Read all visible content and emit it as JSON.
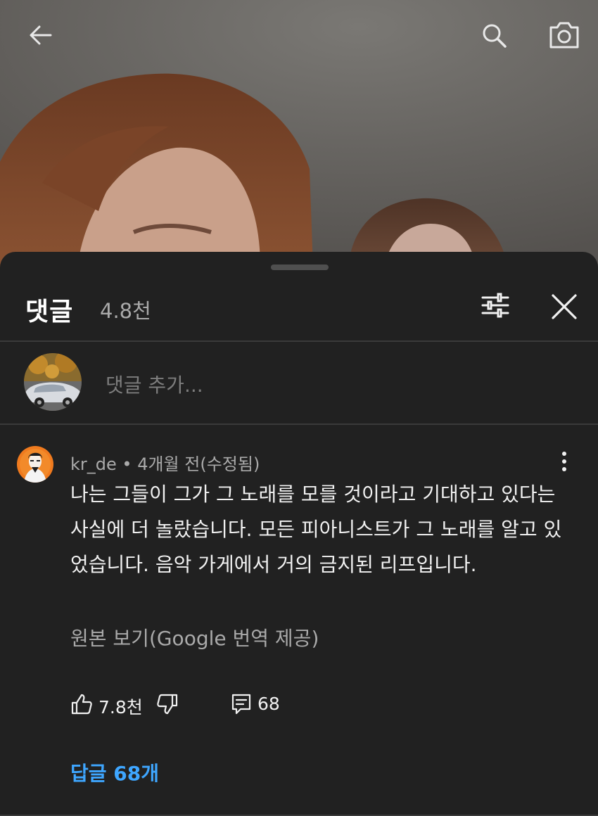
{
  "video": {
    "icons": {
      "back": "arrow-left-icon",
      "search": "search-icon",
      "camera": "camera-icon"
    }
  },
  "comments_panel": {
    "title": "댓글",
    "count": "4.8천",
    "icons": {
      "filter": "sliders-icon",
      "close": "close-icon"
    }
  },
  "composer": {
    "placeholder": "댓글 추가..."
  },
  "comment": {
    "author": "kr_de",
    "separator": "•",
    "time": "4개월 전(수정됨)",
    "body": "나는 그들이 그가 그 노래를 모를 것이라고 기대하고 있다는 사실에 더 놀랐습니다. 모든 피아니스트가 그 노래를 알고 있었습니다. 음악 가게에서 거의 금지된 리프입니다.",
    "translation_link": "원본 보기(Google 번역 제공)",
    "likes": "7.8천",
    "reply_count": "68",
    "replies_link": "답글 68개"
  },
  "colors": {
    "sheet_bg": "#212121",
    "primary_text": "#f1f1f1",
    "secondary_text": "#aaaaaa",
    "link_blue": "#3ea6ff"
  }
}
